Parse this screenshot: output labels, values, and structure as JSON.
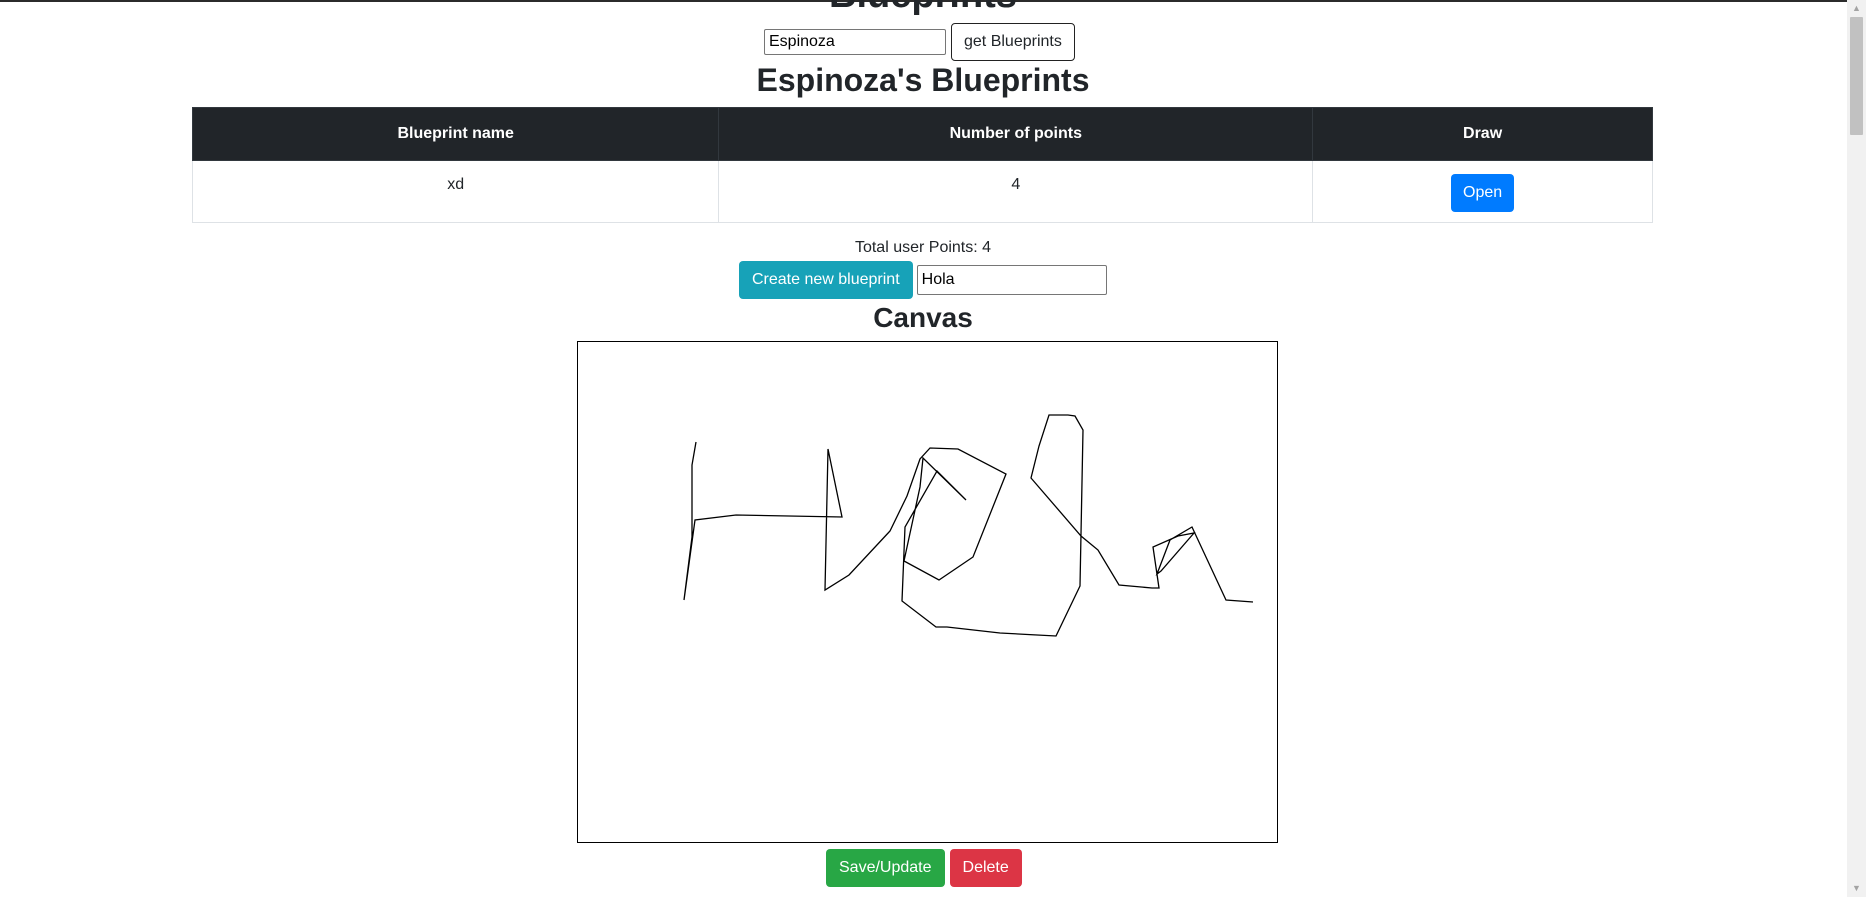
{
  "page": {
    "title": "Blueprints",
    "author_input_value": "Espinoza",
    "get_button_label": "get Blueprints",
    "blueprints_heading": "Espinoza's Blueprints",
    "total_points_label": "Total user Points: 4",
    "create_button_label": "Create new blueprint",
    "new_name_value": "Hola",
    "canvas_title": "Canvas",
    "save_button_label": "Save/Update",
    "delete_button_label": "Delete"
  },
  "table": {
    "headers": [
      "Blueprint name",
      "Number of points",
      "Draw"
    ],
    "rows": [
      {
        "name": "xd",
        "points": "4",
        "action": "Open"
      }
    ]
  },
  "icons": {
    "scroll_up": "chevron-up-icon",
    "scroll_down": "chevron-down-icon"
  }
}
